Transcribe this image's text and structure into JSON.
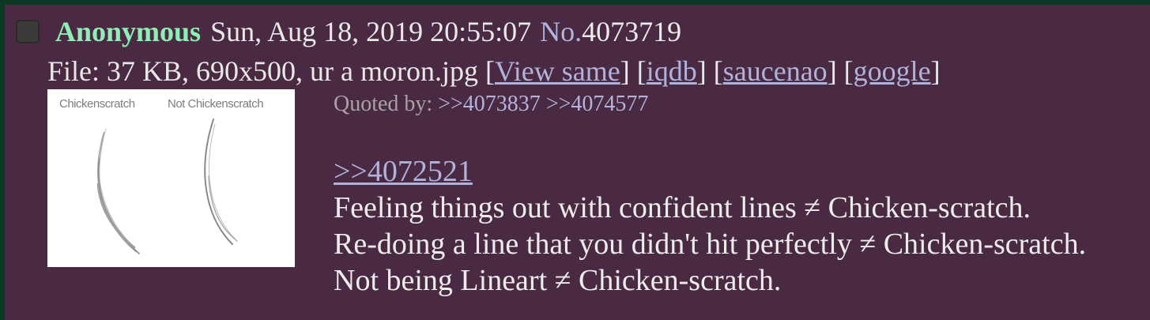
{
  "post": {
    "name": "Anonymous",
    "date": "Sun, Aug 18, 2019 20:55:07",
    "number_label": "No.",
    "number": "4073719"
  },
  "file": {
    "prefix": "File: 37 KB, 690x500, ur a moron.jpg [",
    "links": [
      "View same",
      "iqdb",
      "saucenao",
      "google"
    ],
    "sep": "] [",
    "suffix": "]"
  },
  "thumbnail": {
    "left_label": "Chickenscratch",
    "right_label": "Not Chickenscratch"
  },
  "quoted_by": {
    "label": "Quoted by: ",
    "refs": [
      ">>4073837",
      ">>4074577"
    ]
  },
  "message": {
    "quote_link": ">>4072521",
    "lines": [
      "Feeling things out with confident lines ≠ Chicken-scratch.",
      "Re-doing a line that you didn't hit perfectly ≠ Chicken-scratch.",
      "Not being Lineart ≠ Chicken-scratch."
    ]
  },
  "colors": {
    "background": "#4a2a42",
    "border": "#0c3a24",
    "name": "#8cf0b4",
    "link": "#b0b2da"
  }
}
